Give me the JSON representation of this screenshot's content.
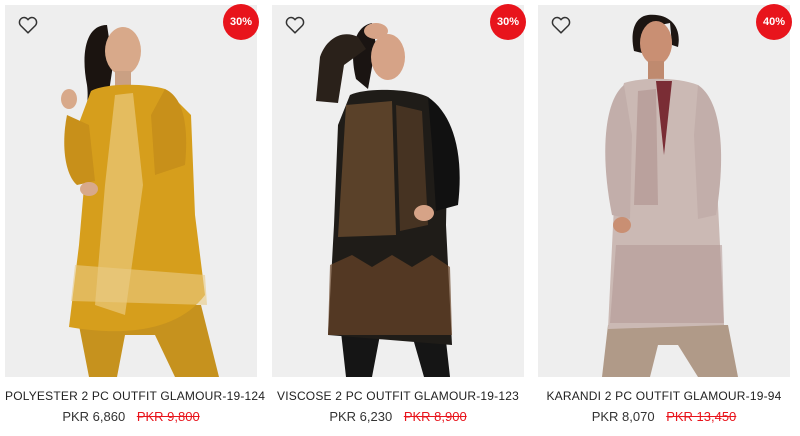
{
  "products": [
    {
      "title": "POLYESTER 2 PC OUTFIT GLAMOUR-19-124",
      "price": "PKR 6,860",
      "old_price": "PKR 9,800",
      "discount": "30%",
      "wishlist_icon": "heart-outline-icon",
      "garment_color": "#d19a1c"
    },
    {
      "title": "VISCOSE 2 PC OUTFIT GLAMOUR-19-123",
      "price": "PKR 6,230",
      "old_price": "PKR 8,900",
      "discount": "30%",
      "wishlist_icon": "heart-outline-icon",
      "garment_color": "#1c1a18"
    },
    {
      "title": "KARANDI 2 PC OUTFIT GLAMOUR-19-94",
      "price": "PKR 8,070",
      "old_price": "PKR 13,450",
      "discount": "40%",
      "wishlist_icon": "heart-outline-icon",
      "garment_color": "#c9b7b3"
    }
  ],
  "colors": {
    "badge": "#e8141c",
    "old_price": "#e8141c",
    "text": "#222222"
  }
}
